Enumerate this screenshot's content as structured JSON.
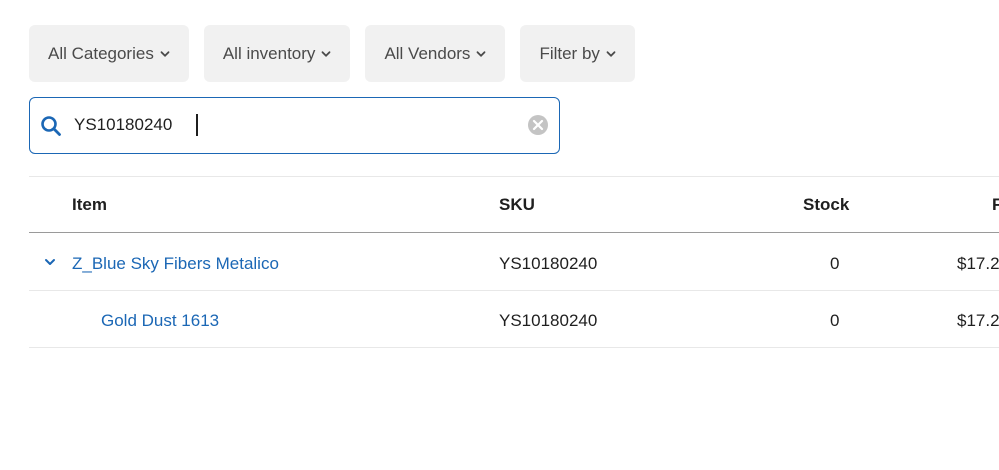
{
  "filters": [
    {
      "label": "All Categories"
    },
    {
      "label": "All inventory"
    },
    {
      "label": "All Vendors"
    },
    {
      "label": "Filter by"
    }
  ],
  "search": {
    "value": "YS10180240",
    "placeholder": ""
  },
  "table": {
    "columns": {
      "item": "Item",
      "sku": "SKU",
      "stock": "Stock",
      "price": "F"
    },
    "rows": [
      {
        "item": "Z_Blue Sky Fibers Metalico",
        "sku": "YS10180240",
        "stock": "0",
        "price": "$17.2",
        "expandable": true
      },
      {
        "item": "Gold Dust 1613",
        "sku": "YS10180240",
        "stock": "0",
        "price": "$17.2",
        "expandable": false
      }
    ]
  },
  "colors": {
    "accent": "#1b67b5",
    "filter_bg": "#f1f1f1"
  },
  "icons": {
    "search": "search-icon",
    "clear": "clear-icon",
    "chevron": "chevron-down-icon"
  }
}
